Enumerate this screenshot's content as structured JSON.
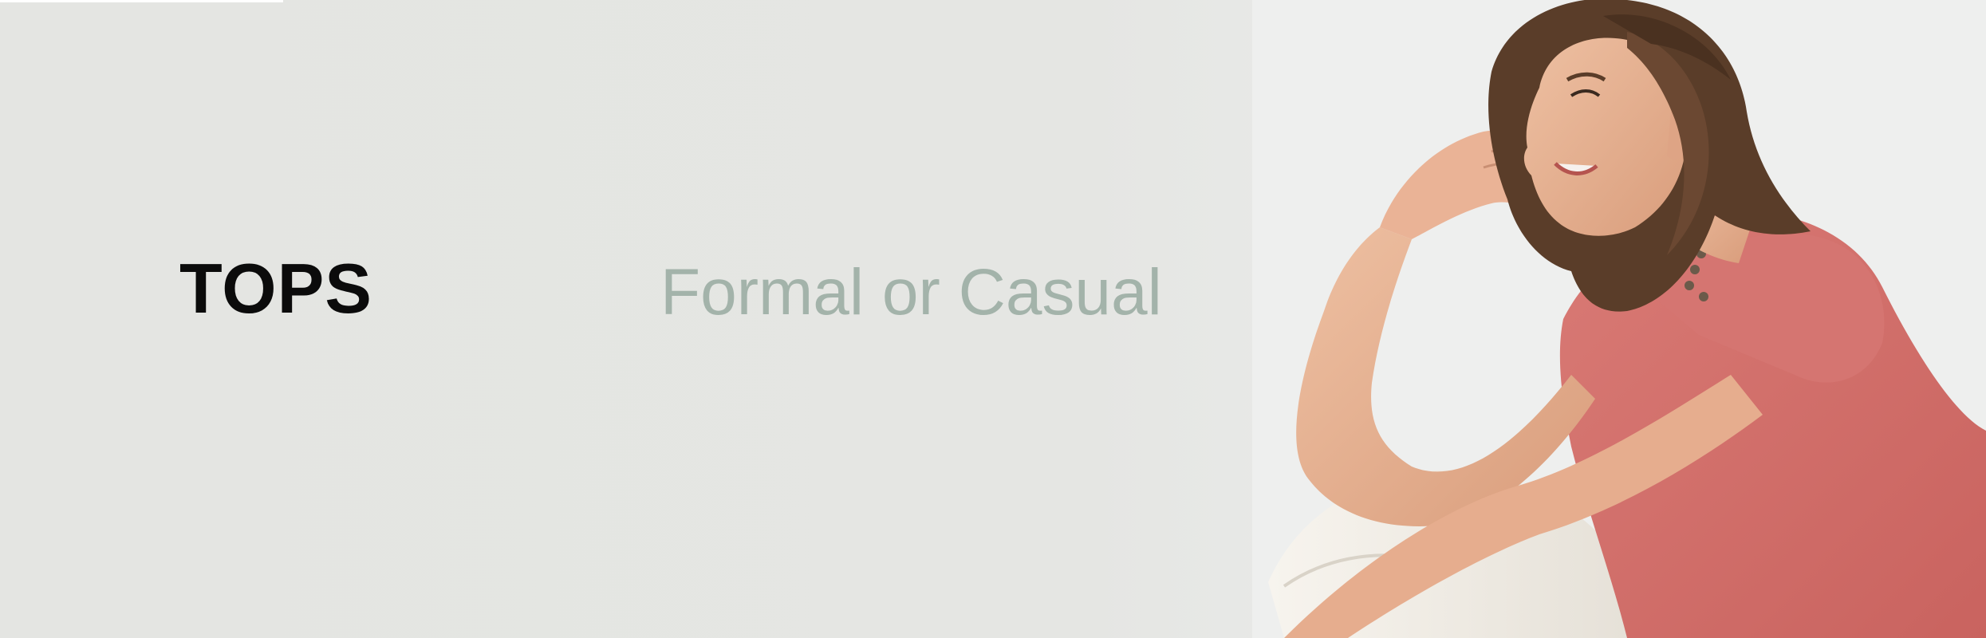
{
  "banner": {
    "title": "TOPS",
    "subtitle": "Formal or Casual",
    "image": {
      "subject": "smiling woman with brown hair in pink short-sleeve top and white pants",
      "colors": {
        "top": "#d2716d",
        "hair": "#5a3d29",
        "skin": "#e8b596",
        "pants": "#f3f0ea"
      }
    },
    "colors": {
      "background": "#e5e6e3",
      "title": "#0b0b0b",
      "subtitle": "#a3b3aa"
    }
  }
}
